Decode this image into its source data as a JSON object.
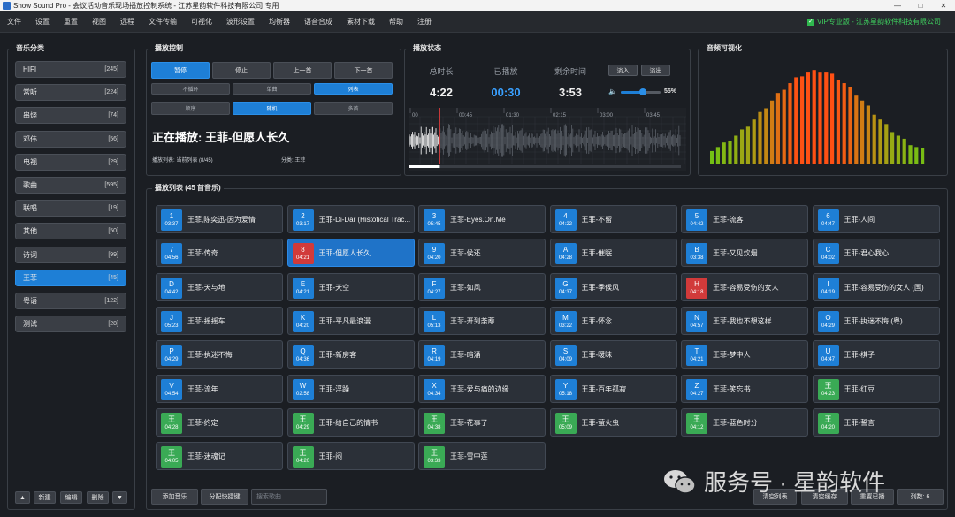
{
  "window": {
    "title": "Show Sound Pro - 会议活动音乐现场播放控制系统 - 江苏星韵软件科技有限公司 专用"
  },
  "menu": [
    "文件",
    "设置",
    "重置",
    "视图",
    "远程",
    "文件传输",
    "可视化",
    "波形设置",
    "均衡器",
    "语音合成",
    "素材下载",
    "帮助",
    "注册"
  ],
  "vip": "VIP专业版 - 江苏星韵软件科技有限公司",
  "categories": {
    "title": "音乐分类",
    "items": [
      {
        "label": "HIFI",
        "count": "[245]"
      },
      {
        "label": "常听",
        "count": "[224]"
      },
      {
        "label": "串烧",
        "count": "[74]"
      },
      {
        "label": "邓伟",
        "count": "[56]"
      },
      {
        "label": "电视",
        "count": "[29]"
      },
      {
        "label": "歌曲",
        "count": "[595]"
      },
      {
        "label": "联唱",
        "count": "[19]"
      },
      {
        "label": "其他",
        "count": "[50]"
      },
      {
        "label": "诗词",
        "count": "[99]"
      },
      {
        "label": "王菲",
        "count": "[45]"
      },
      {
        "label": "粤语",
        "count": "[122]"
      },
      {
        "label": "测试",
        "count": "[28]"
      }
    ],
    "buttons": {
      "up": "▲",
      "add": "新建",
      "edit": "编辑",
      "del": "删除",
      "down": "▼"
    }
  },
  "control": {
    "title": "播放控制",
    "buttons": [
      "暂停",
      "停止",
      "上一首",
      "下一首"
    ],
    "modes": [
      "不循环",
      "单曲",
      "列表"
    ],
    "orders": [
      "顺序",
      "随机",
      "多首"
    ],
    "now_playing": "正在播放: 王菲-但愿人长久",
    "playlist_info": "播放列表: 当前列表 (8/45)",
    "category_info": "分类: 王菲"
  },
  "status": {
    "title": "播放状态",
    "total_label": "总时长",
    "elapsed_label": "已播放",
    "remain_label": "剩余时间",
    "total": "4:22",
    "elapsed": "00:30",
    "remain": "3:53",
    "fade_in": "淡入",
    "fade_out": "淡出",
    "volume": "55%",
    "volume_level": 0.55,
    "progress": 0.115,
    "timeline": [
      "00",
      "00:45",
      "01:30",
      "02:15",
      "03:00",
      "03:45"
    ]
  },
  "visual": {
    "title": "音频可视化"
  },
  "playlist": {
    "title": "播放列表 (45 首音乐)",
    "songs": [
      {
        "k": "1",
        "d": "03:37",
        "n": "王菲,陈奕迅-因为爱情",
        "c": "blue"
      },
      {
        "k": "2",
        "d": "03:17",
        "n": "王菲-Di-Dar (Histotical Trac...",
        "c": "blue"
      },
      {
        "k": "3",
        "d": "05:45",
        "n": "王菲-Eyes.On.Me",
        "c": "blue"
      },
      {
        "k": "4",
        "d": "04:22",
        "n": "王菲-不留",
        "c": "blue"
      },
      {
        "k": "5",
        "d": "04:42",
        "n": "王菲-流客",
        "c": "blue"
      },
      {
        "k": "6",
        "d": "04:47",
        "n": "王菲-人间",
        "c": "blue"
      },
      {
        "k": "7",
        "d": "04:56",
        "n": "王菲-传奇",
        "c": "blue"
      },
      {
        "k": "8",
        "d": "04:21",
        "n": "王菲-但愿人长久",
        "c": "red",
        "active": true
      },
      {
        "k": "9",
        "d": "04:20",
        "n": "王菲-侯还",
        "c": "blue"
      },
      {
        "k": "A",
        "d": "04:28",
        "n": "王菲-催眠",
        "c": "blue"
      },
      {
        "k": "B",
        "d": "03:38",
        "n": "王菲-又见炊烟",
        "c": "blue"
      },
      {
        "k": "C",
        "d": "04:02",
        "n": "王菲-君心我心",
        "c": "blue"
      },
      {
        "k": "D",
        "d": "04:42",
        "n": "王菲-天与地",
        "c": "blue"
      },
      {
        "k": "E",
        "d": "04:21",
        "n": "王菲-天空",
        "c": "blue"
      },
      {
        "k": "F",
        "d": "04:27",
        "n": "王菲-如风",
        "c": "blue"
      },
      {
        "k": "G",
        "d": "04:37",
        "n": "王菲-季候风",
        "c": "blue"
      },
      {
        "k": "H",
        "d": "04:18",
        "n": "王菲-容易受伤的女人",
        "c": "red"
      },
      {
        "k": "I",
        "d": "04:19",
        "n": "王菲-容易受伤的女人 (国)",
        "c": "blue"
      },
      {
        "k": "J",
        "d": "05:23",
        "n": "王菲-摇摇车",
        "c": "blue"
      },
      {
        "k": "K",
        "d": "04:20",
        "n": "王菲-平凡最浪漫",
        "c": "blue"
      },
      {
        "k": "L",
        "d": "05:13",
        "n": "王菲-开到荼蘼",
        "c": "blue"
      },
      {
        "k": "M",
        "d": "03:22",
        "n": "王菲-怀念",
        "c": "blue"
      },
      {
        "k": "N",
        "d": "04:57",
        "n": "王菲-我也不想这样",
        "c": "blue"
      },
      {
        "k": "O",
        "d": "04:29",
        "n": "王菲-执迷不悔 (粤)",
        "c": "blue"
      },
      {
        "k": "P",
        "d": "04:29",
        "n": "王菲-执迷不悔",
        "c": "blue"
      },
      {
        "k": "Q",
        "d": "04:36",
        "n": "王菲-新房客",
        "c": "blue"
      },
      {
        "k": "R",
        "d": "04:19",
        "n": "王菲-暗涌",
        "c": "blue"
      },
      {
        "k": "S",
        "d": "04:09",
        "n": "王菲-暧昧",
        "c": "blue"
      },
      {
        "k": "T",
        "d": "04:21",
        "n": "王菲-梦中人",
        "c": "blue"
      },
      {
        "k": "U",
        "d": "04:47",
        "n": "王菲-棋子",
        "c": "blue"
      },
      {
        "k": "V",
        "d": "04:54",
        "n": "王菲-流年",
        "c": "blue"
      },
      {
        "k": "W",
        "d": "02:58",
        "n": "王菲-浮躁",
        "c": "blue"
      },
      {
        "k": "X",
        "d": "04:34",
        "n": "王菲-爱与痛的边缘",
        "c": "blue"
      },
      {
        "k": "Y",
        "d": "05:18",
        "n": "王菲-百年孤寂",
        "c": "blue"
      },
      {
        "k": "Z",
        "d": "04:27",
        "n": "王菲-笑忘书",
        "c": "blue"
      },
      {
        "k": "王",
        "d": "04:23",
        "n": "王菲-红豆",
        "c": "green"
      },
      {
        "k": "王",
        "d": "04:28",
        "n": "王菲-约定",
        "c": "green"
      },
      {
        "k": "王",
        "d": "04:29",
        "n": "王菲-给自己的情书",
        "c": "green"
      },
      {
        "k": "王",
        "d": "04:38",
        "n": "王菲-花事了",
        "c": "green"
      },
      {
        "k": "王",
        "d": "05:09",
        "n": "王菲-萤火虫",
        "c": "green"
      },
      {
        "k": "王",
        "d": "04:12",
        "n": "王菲-蓝色时分",
        "c": "green"
      },
      {
        "k": "王",
        "d": "04:20",
        "n": "王菲-誓言",
        "c": "green"
      },
      {
        "k": "王",
        "d": "04:05",
        "n": "王菲-迷魂记",
        "c": "green"
      },
      {
        "k": "王",
        "d": "04:20",
        "n": "王菲-闷",
        "c": "green"
      },
      {
        "k": "王",
        "d": "03:33",
        "n": "王菲-雪中莲",
        "c": "green"
      }
    ]
  },
  "bottom": {
    "add_music": "添加音乐",
    "assign_hotkey": "分配快捷键",
    "search_placeholder": "搜索歌曲...",
    "clear_list": "清空列表",
    "clear_cache": "清空缓存",
    "reset_played": "重置已播",
    "columns": "列数: 6"
  },
  "watermark": "服务号 · 星韵软件"
}
